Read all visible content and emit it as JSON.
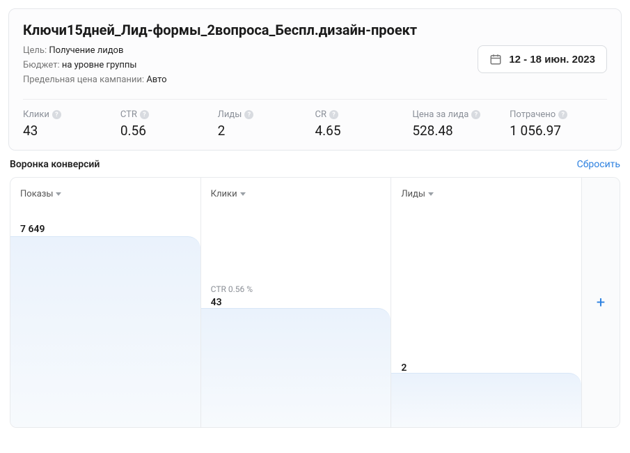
{
  "header": {
    "title": "Ключи15дней_Лид-формы_2вопроса_Беспл.дизайн-проект",
    "goal_label": "Цель:",
    "goal_value": "Получение лидов",
    "budget_label": "Бюджет:",
    "budget_value": "на уровне группы",
    "limit_label": "Предельная цена кампании:",
    "limit_value": "Авто",
    "date_range": "12 - 18 июн. 2023"
  },
  "stats": [
    {
      "label": "Клики",
      "value": "43"
    },
    {
      "label": "CTR",
      "value": "0.56"
    },
    {
      "label": "Лиды",
      "value": "2"
    },
    {
      "label": "CR",
      "value": "4.65"
    },
    {
      "label": "Цена за лида",
      "value": "528.48"
    },
    {
      "label": "Потрачено",
      "value": "1 056.97"
    }
  ],
  "funnel": {
    "title": "Воронка конверсий",
    "reset": "Сбросить",
    "cols": [
      {
        "name": "Показы",
        "rate": "",
        "value": "7 649",
        "height_pct": 88,
        "val_top_pct": 6
      },
      {
        "name": "Клики",
        "rate": "CTR 0.56 %",
        "value": "43",
        "height_pct": 55,
        "val_top_pct": 40
      },
      {
        "name": "Лиды",
        "rate": "",
        "value": "2",
        "height_pct": 25,
        "val_top_pct": 70
      }
    ]
  },
  "chart_data": {
    "type": "bar",
    "title": "Воронка конверсий",
    "series": [
      {
        "name": "Показы",
        "value": 7649
      },
      {
        "name": "Клики",
        "value": 43,
        "rate_label": "CTR 0.56 %"
      },
      {
        "name": "Лиды",
        "value": 2
      }
    ]
  }
}
